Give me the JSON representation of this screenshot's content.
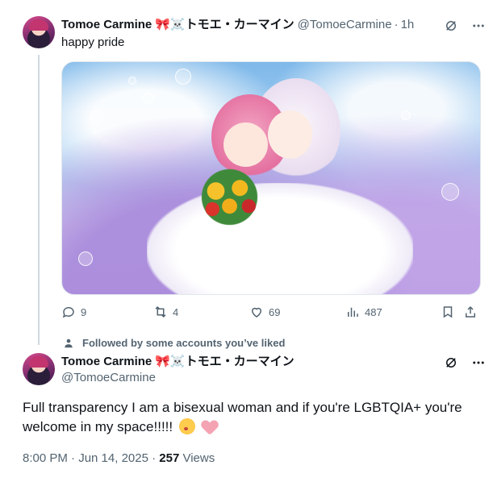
{
  "colors": {
    "text_primary": "#0f1419",
    "text_secondary": "#536471",
    "thread_line": "#cfd9de",
    "border": "#e1e8ed",
    "bow_emoji": "#e0245e"
  },
  "reply_tweet": {
    "author_name": "Tomoe Carmine",
    "name_emoji": "🎀☠️",
    "name_japanese": "トモエ・カーマイン",
    "handle": "@TomoeCarmine",
    "separator": "·",
    "time_ago": "1h",
    "text": "happy pride",
    "image_alt": "anime-wedding-illustration",
    "stats": {
      "replies": "9",
      "reposts": "4",
      "likes": "69",
      "views": "487"
    },
    "icons": [
      "grok-icon",
      "more-icon",
      "reply-icon",
      "repost-icon",
      "like-icon",
      "views-icon",
      "bookmark-icon",
      "share-icon"
    ]
  },
  "social_context": {
    "text": "Followed by some accounts you’ve liked",
    "icon": "person-icon"
  },
  "main_tweet": {
    "author_name": "Tomoe Carmine",
    "name_emoji": "🎀☠️",
    "name_japanese": "トモエ・カーマイン",
    "handle": "@TomoeCarmine",
    "text": "Full transparency I am a bisexual woman and if you're LGBTQIA+ you're welcome in my space!!!!!",
    "emojis": [
      "kissing-face-emoji",
      "pink-heart-emoji"
    ],
    "timestamp": "8:00 PM · Jun 14, 2025 · ",
    "views_count": "257",
    "views_label": " Views"
  }
}
